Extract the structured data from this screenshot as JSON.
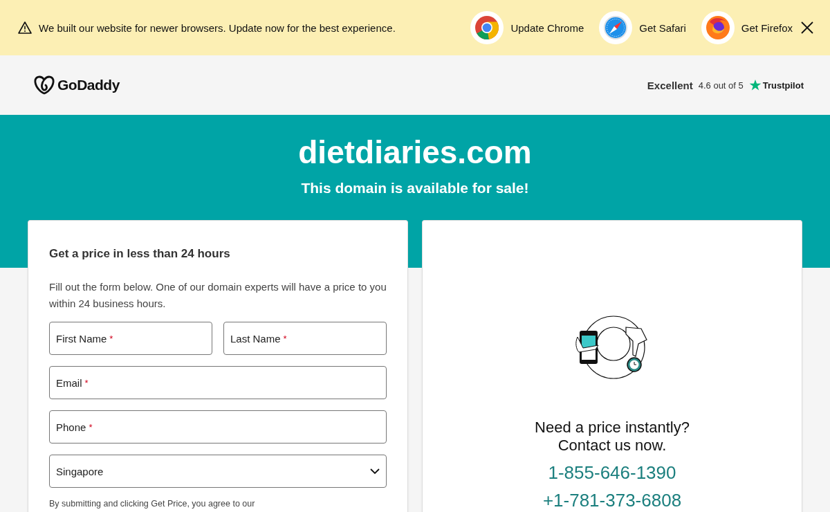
{
  "banner": {
    "message": "We built our website for newer browsers. Update now for the best experience.",
    "browsers": [
      {
        "kind": "chrome",
        "label": "Update Chrome"
      },
      {
        "kind": "safari",
        "label": "Get Safari"
      },
      {
        "kind": "firefox",
        "label": "Get Firefox"
      }
    ]
  },
  "header": {
    "logo": "GoDaddy",
    "rating": {
      "word": "Excellent",
      "score": "4.6 out of 5",
      "brand": "Trustpilot"
    }
  },
  "hero": {
    "domain": "dietdiaries.com",
    "subtitle": "This domain is available for sale!"
  },
  "form": {
    "heading": "Get a price in less than 24 hours",
    "intro": "Fill out the form below. One of our domain experts will have a price to you within 24 business hours.",
    "rows": [
      [
        {
          "label": "First Name",
          "required_mark": "*"
        },
        {
          "label": "Last Name",
          "required_mark": "*"
        }
      ],
      [
        {
          "label": "Email",
          "required_mark": "*"
        }
      ],
      [
        {
          "label": "Phone",
          "required_mark": "*"
        }
      ]
    ],
    "country": {
      "value": "Singapore"
    },
    "terms": "By submitting and clicking Get Price, you agree to our"
  },
  "contact": {
    "heading": "Need a price instantly?",
    "subheading": "Contact us now.",
    "phones": [
      "1-855-646-1390",
      "+1-781-373-6808"
    ]
  }
}
